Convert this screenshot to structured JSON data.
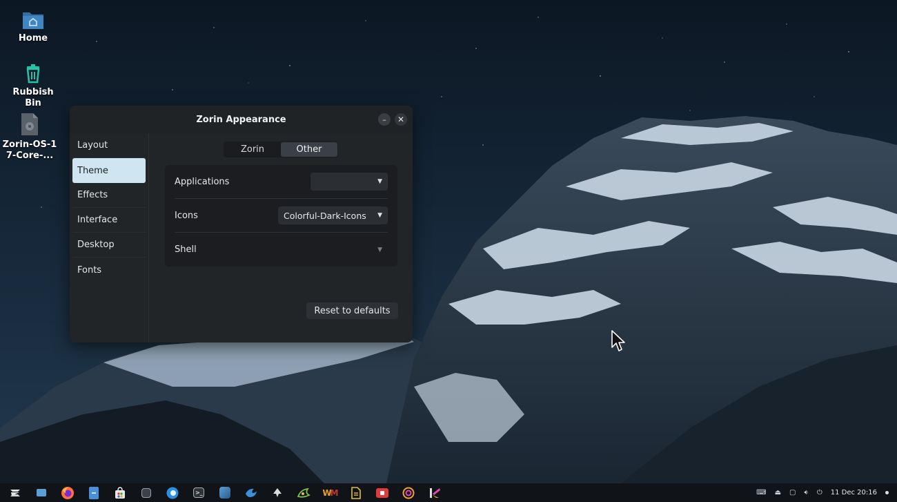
{
  "desktop": {
    "icons": [
      {
        "label": "Home"
      },
      {
        "label": "Rubbish Bin"
      },
      {
        "label": "Zorin-OS-17-Core-..."
      }
    ]
  },
  "window": {
    "title": "Zorin Appearance",
    "minimize_label": "–",
    "close_label": "✕",
    "sidebar": [
      {
        "label": "Layout"
      },
      {
        "label": "Theme",
        "active": true
      },
      {
        "label": "Effects"
      },
      {
        "label": "Interface"
      },
      {
        "label": "Desktop"
      },
      {
        "label": "Fonts"
      }
    ],
    "segmented": {
      "options": [
        "Zorin",
        "Other"
      ],
      "selected": "Other"
    },
    "settings": {
      "applications": {
        "label": "Applications",
        "value": ""
      },
      "icons": {
        "label": "Icons",
        "value": "Colorful-Dark-Icons"
      },
      "shell": {
        "label": "Shell",
        "value": ""
      }
    },
    "reset_label": "Reset to defaults"
  },
  "taskbar": {
    "apps": [
      {
        "name": "zorin-menu",
        "icon": "zorin-logo-icon",
        "color": "#ffffff"
      },
      {
        "name": "workspaces",
        "icon": "workspace-icon",
        "color": "#5a9fd6"
      },
      {
        "name": "firefox",
        "icon": "firefox-icon",
        "color": "#ff7139"
      },
      {
        "name": "files",
        "icon": "files-icon",
        "color": "#4a90d9"
      },
      {
        "name": "software",
        "icon": "software-store-icon",
        "color": "#e0e0e0"
      },
      {
        "name": "app-6",
        "icon": "app-box-icon",
        "color": "#9aa0a6"
      },
      {
        "name": "app-7",
        "icon": "browser-icon",
        "color": "#2a8fe0"
      },
      {
        "name": "terminal",
        "icon": "terminal-icon",
        "color": "#2f3438"
      },
      {
        "name": "app-9",
        "icon": "image-viewer-icon",
        "color": "#3b6fa0"
      },
      {
        "name": "app-10",
        "icon": "bird-icon",
        "color": "#3c8fd8"
      },
      {
        "name": "app-11",
        "icon": "inkscape-icon",
        "color": "#dddddd"
      },
      {
        "name": "app-12",
        "icon": "paint-icon",
        "color": "#7ec04a"
      },
      {
        "name": "app-13",
        "icon": "wm-icon",
        "color": "#e8a020"
      },
      {
        "name": "app-14",
        "icon": "document-icon",
        "color": "#e6c030"
      },
      {
        "name": "app-15",
        "icon": "toolbox-icon",
        "color": "#e03a3a"
      },
      {
        "name": "app-16",
        "icon": "target-icon",
        "color": "#f0a030"
      },
      {
        "name": "app-17",
        "icon": "kdenlive-icon",
        "color": "#e04ab0"
      }
    ],
    "tray": {
      "clock": "11 Dec 20:16"
    }
  }
}
